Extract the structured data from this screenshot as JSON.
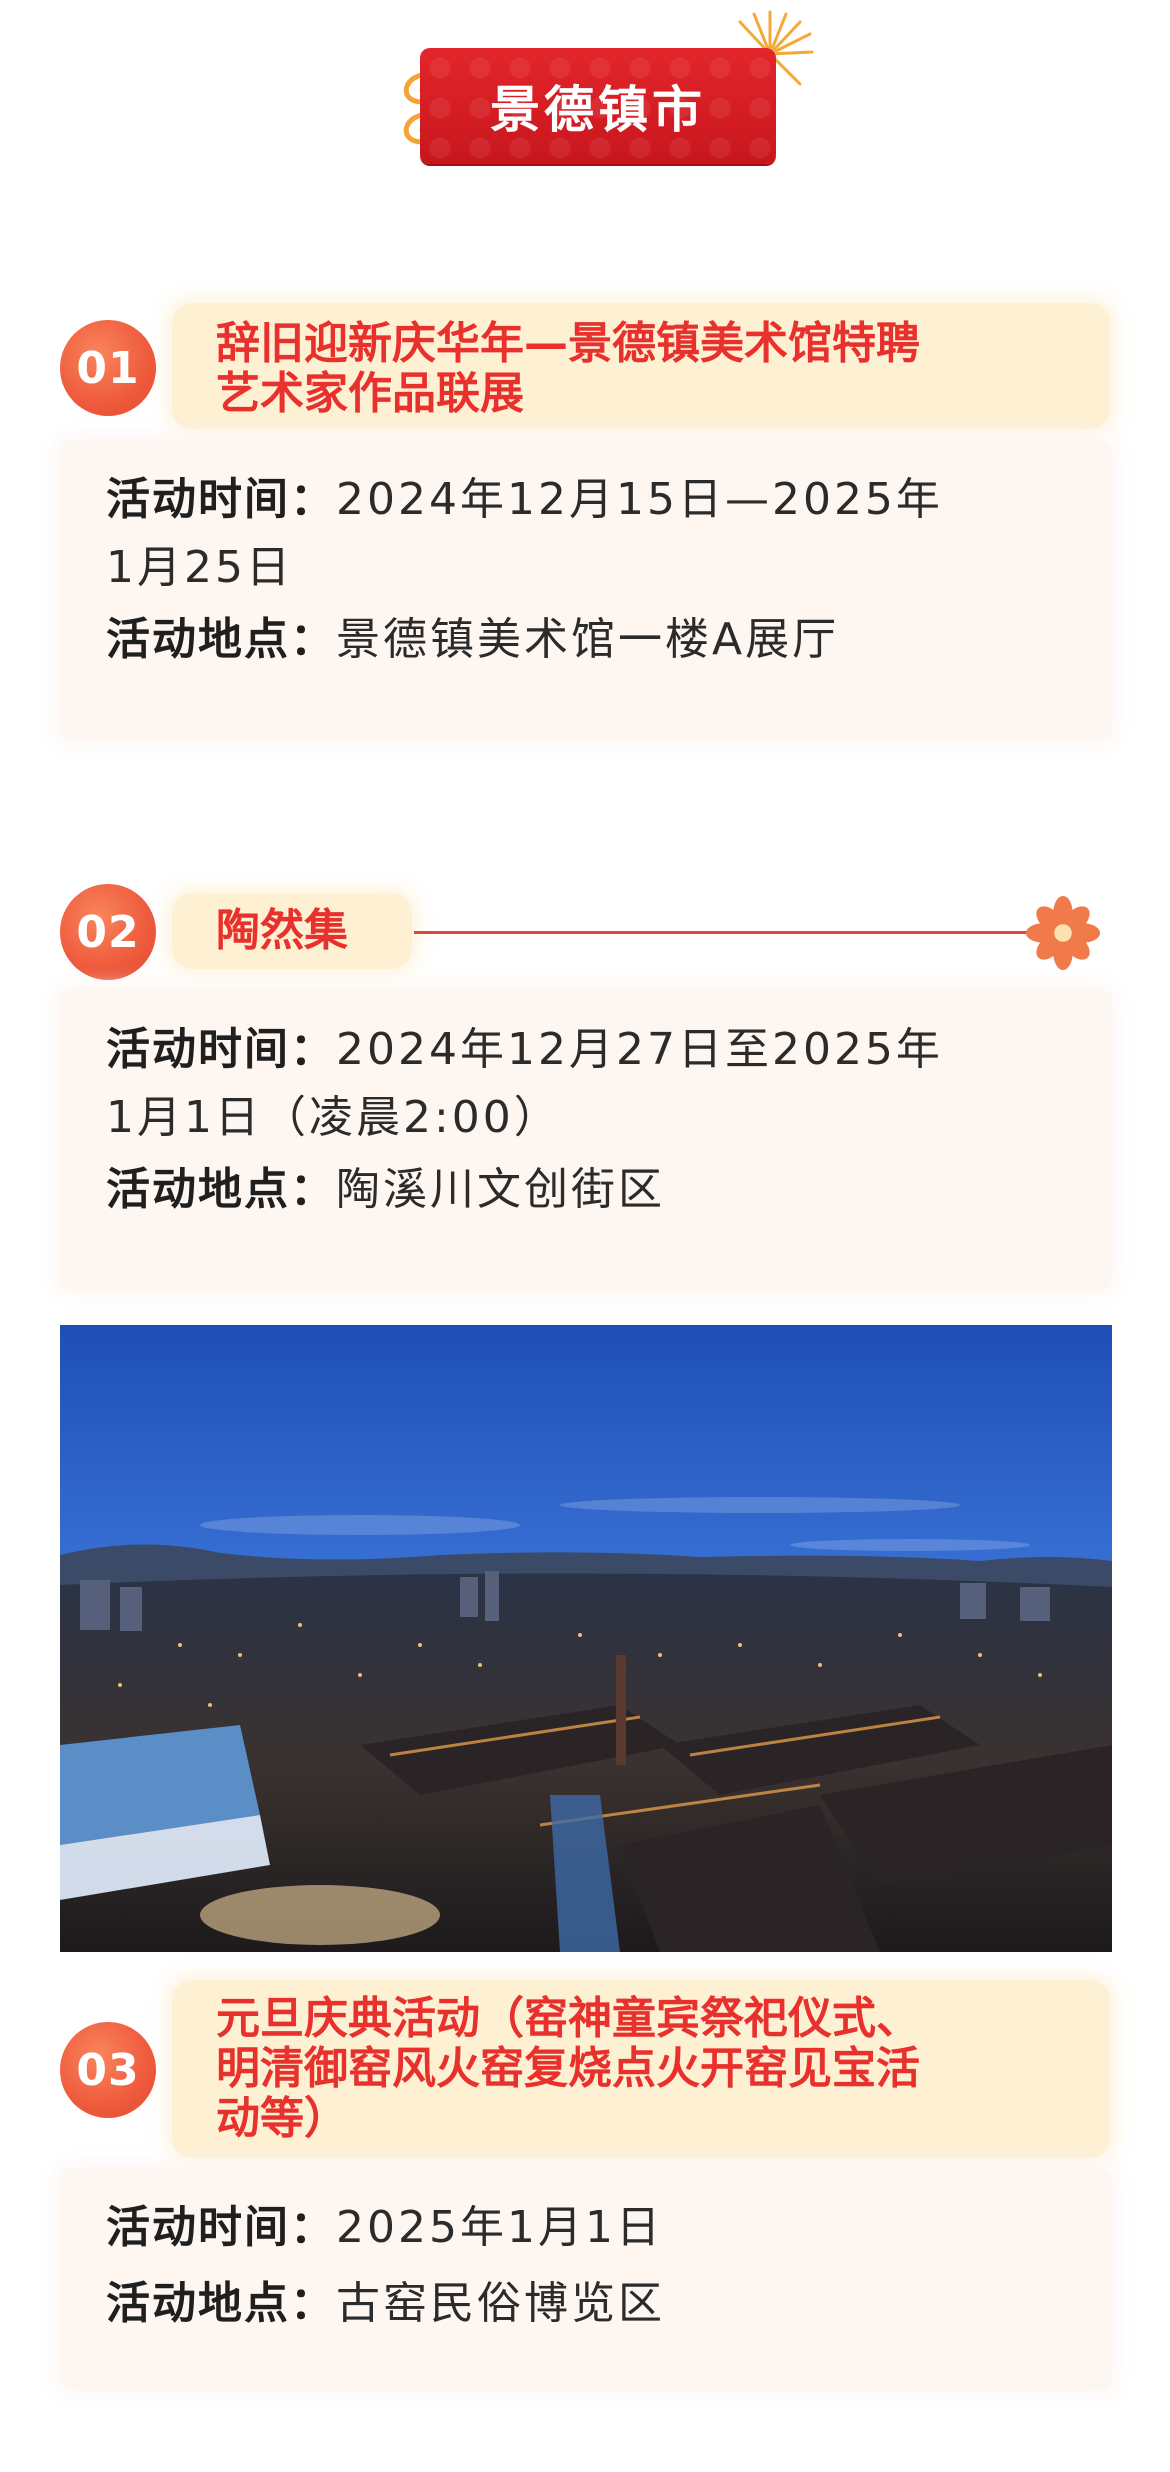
{
  "header": {
    "title": "景德镇市"
  },
  "colors": {
    "accent_red": "#e3262b",
    "title_text": "#e8302c",
    "number_circle": "#ee5a3c",
    "title_bg": "#fdf0d3",
    "card_bg": "#fdf6f1"
  },
  "events": [
    {
      "number": "01",
      "title_line1": "辞旧迎新庆华年—景德镇美术馆特聘",
      "title_line2": "艺术家作品联展",
      "time_label": "活动时间：",
      "time_line1": "2024年12月15日—2025年",
      "time_line2": "1月25日",
      "place_label": "活动地点：",
      "place": "景德镇美术馆一楼A展厅"
    },
    {
      "number": "02",
      "title_line1": "陶然集",
      "time_label": "活动时间：",
      "time_line1": "2024年12月27日至2025年",
      "time_line2": "1月1日（凌晨2:00）",
      "place_label": "活动地点：",
      "place": "陶溪川文创街区"
    },
    {
      "number": "03",
      "title_line1": "元旦庆典活动（窑神童宾祭祀仪式、",
      "title_line2": "明清御窑风火窑复烧点火开窑见宝活",
      "title_line3": "动等）",
      "time_label": "活动时间：",
      "time_line1": "2025年1月1日",
      "place_label": "活动地点：",
      "place": "古窑民俗博览区"
    }
  ],
  "photo": {
    "icon": "night-city-aerial-photo"
  }
}
